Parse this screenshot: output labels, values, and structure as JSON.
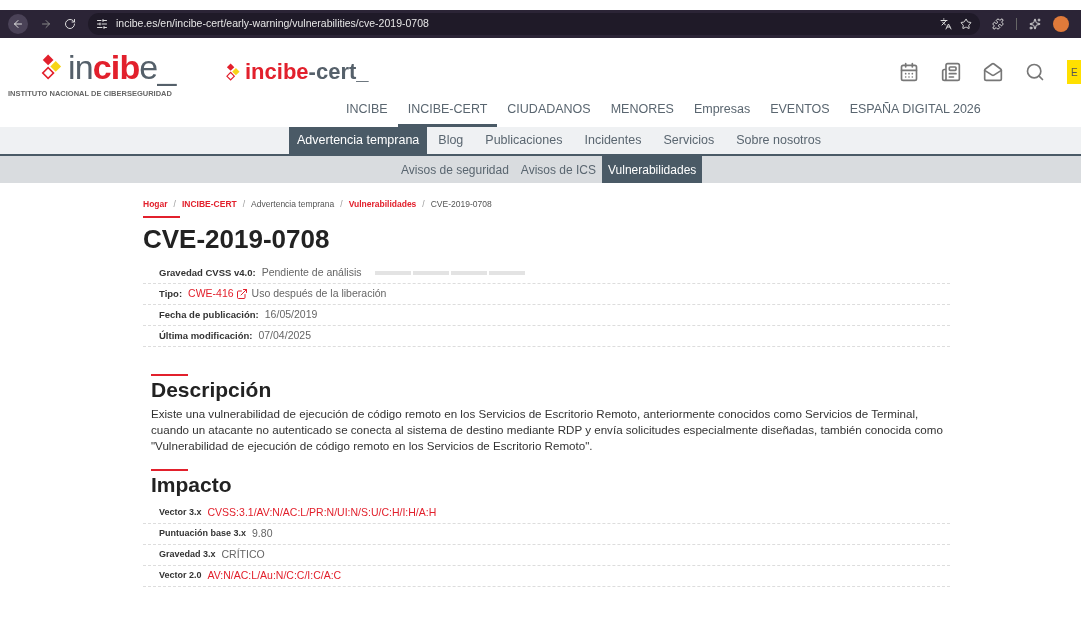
{
  "browser": {
    "url": "incibe.es/en/incibe-cert/early-warning/vulnerabilities/cve-2019-0708"
  },
  "header": {
    "logo": [
      {
        "text": "in",
        "kind": "plain"
      },
      {
        "text": "cib",
        "kind": "accent"
      },
      {
        "text": "e_",
        "kind": "plain"
      }
    ],
    "tagline": "INSTITUTO NACIONAL DE CIBERSEGURIDAD",
    "cert_logo": [
      {
        "text": "incibe",
        "kind": "accent"
      },
      {
        "text": "-cert_",
        "kind": "plain"
      }
    ],
    "language_button": "E"
  },
  "main_nav": [
    {
      "label": "INCIBE",
      "selected": false
    },
    {
      "label": "INCIBE-CERT",
      "selected": true
    },
    {
      "label": "CIUDADANOS",
      "selected": false
    },
    {
      "label": "MENORES",
      "selected": false
    },
    {
      "label": "Empresas",
      "selected": false
    },
    {
      "label": "EVENTOS",
      "selected": false
    },
    {
      "label": "ESPAÑA DIGITAL 2026",
      "selected": false
    }
  ],
  "section_nav": [
    {
      "label": "Advertencia temprana",
      "selected": true
    },
    {
      "label": "Blog",
      "selected": false
    },
    {
      "label": "Publicaciones",
      "selected": false
    },
    {
      "label": "Incidentes",
      "selected": false
    },
    {
      "label": "Servicios",
      "selected": false
    },
    {
      "label": "Sobre nosotros",
      "selected": false
    }
  ],
  "sub_nav": [
    {
      "label": "Avisos de seguridad",
      "selected": false
    },
    {
      "label": "Avisos de ICS",
      "selected": false
    },
    {
      "label": "Vulnerabilidades",
      "selected": true
    }
  ],
  "breadcrumb": [
    {
      "label": "Hogar",
      "kind": "link"
    },
    {
      "label": "/",
      "kind": "separator"
    },
    {
      "label": "INCIBE-CERT",
      "kind": "link"
    },
    {
      "label": "/",
      "kind": "separator"
    },
    {
      "label": "Advertencia temprana",
      "kind": "plain"
    },
    {
      "label": "/",
      "kind": "separator"
    },
    {
      "label": "Vulnerabilidades",
      "kind": "link"
    },
    {
      "label": "/",
      "kind": "separator"
    },
    {
      "label": "CVE-2019-0708",
      "kind": "plain"
    }
  ],
  "title": "CVE-2019-0708",
  "details": [
    {
      "label": "Gravedad CVSS v4.0:",
      "parts": [
        {
          "text": "Pendiente de análisis",
          "kind": "plain"
        }
      ],
      "kind": "meter"
    },
    {
      "label": "Tipo:",
      "parts": [
        {
          "text": "CWE-416",
          "kind": "link"
        },
        {
          "text": "Uso después de la liberación",
          "kind": "plain"
        }
      ]
    },
    {
      "label": "Fecha de publicación:",
      "parts": [
        {
          "text": "16/05/2019",
          "kind": "plain"
        }
      ]
    },
    {
      "label": "Última modificación:",
      "parts": [
        {
          "text": "07/04/2025",
          "kind": "plain"
        }
      ]
    }
  ],
  "description": {
    "heading": "Descripción",
    "text": "Existe una vulnerabilidad de ejecución de código remoto en los Servicios de Escritorio Remoto, anteriormente conocidos como Servicios de Terminal, cuando un atacante no autenticado se conecta al sistema de destino mediante RDP y envía solicitudes especialmente diseñadas, también conocida como \"Vulnerabilidad de ejecución de código remoto en los Servicios de Escritorio Remoto\"."
  },
  "impact": {
    "heading": "Impacto",
    "rows": [
      {
        "label": "Vector 3.x",
        "parts": [
          {
            "text": "CVSS:3.1/AV:N/AC:L/PR:N/UI:N/S:U/C:H/I:H/A:H",
            "kind": "link"
          }
        ]
      },
      {
        "label": "Puntuación base 3.x",
        "parts": [
          {
            "text": "9.80",
            "kind": "plain"
          }
        ]
      },
      {
        "label": "Gravedad 3.x",
        "parts": [
          {
            "text": "CRÍTICO",
            "kind": "plain"
          }
        ]
      },
      {
        "label": "Vector 2.0",
        "parts": [
          {
            "text": "AV:N/AC:L/Au:N/C:C/I:C/A:C",
            "kind": "link"
          }
        ]
      }
    ]
  }
}
